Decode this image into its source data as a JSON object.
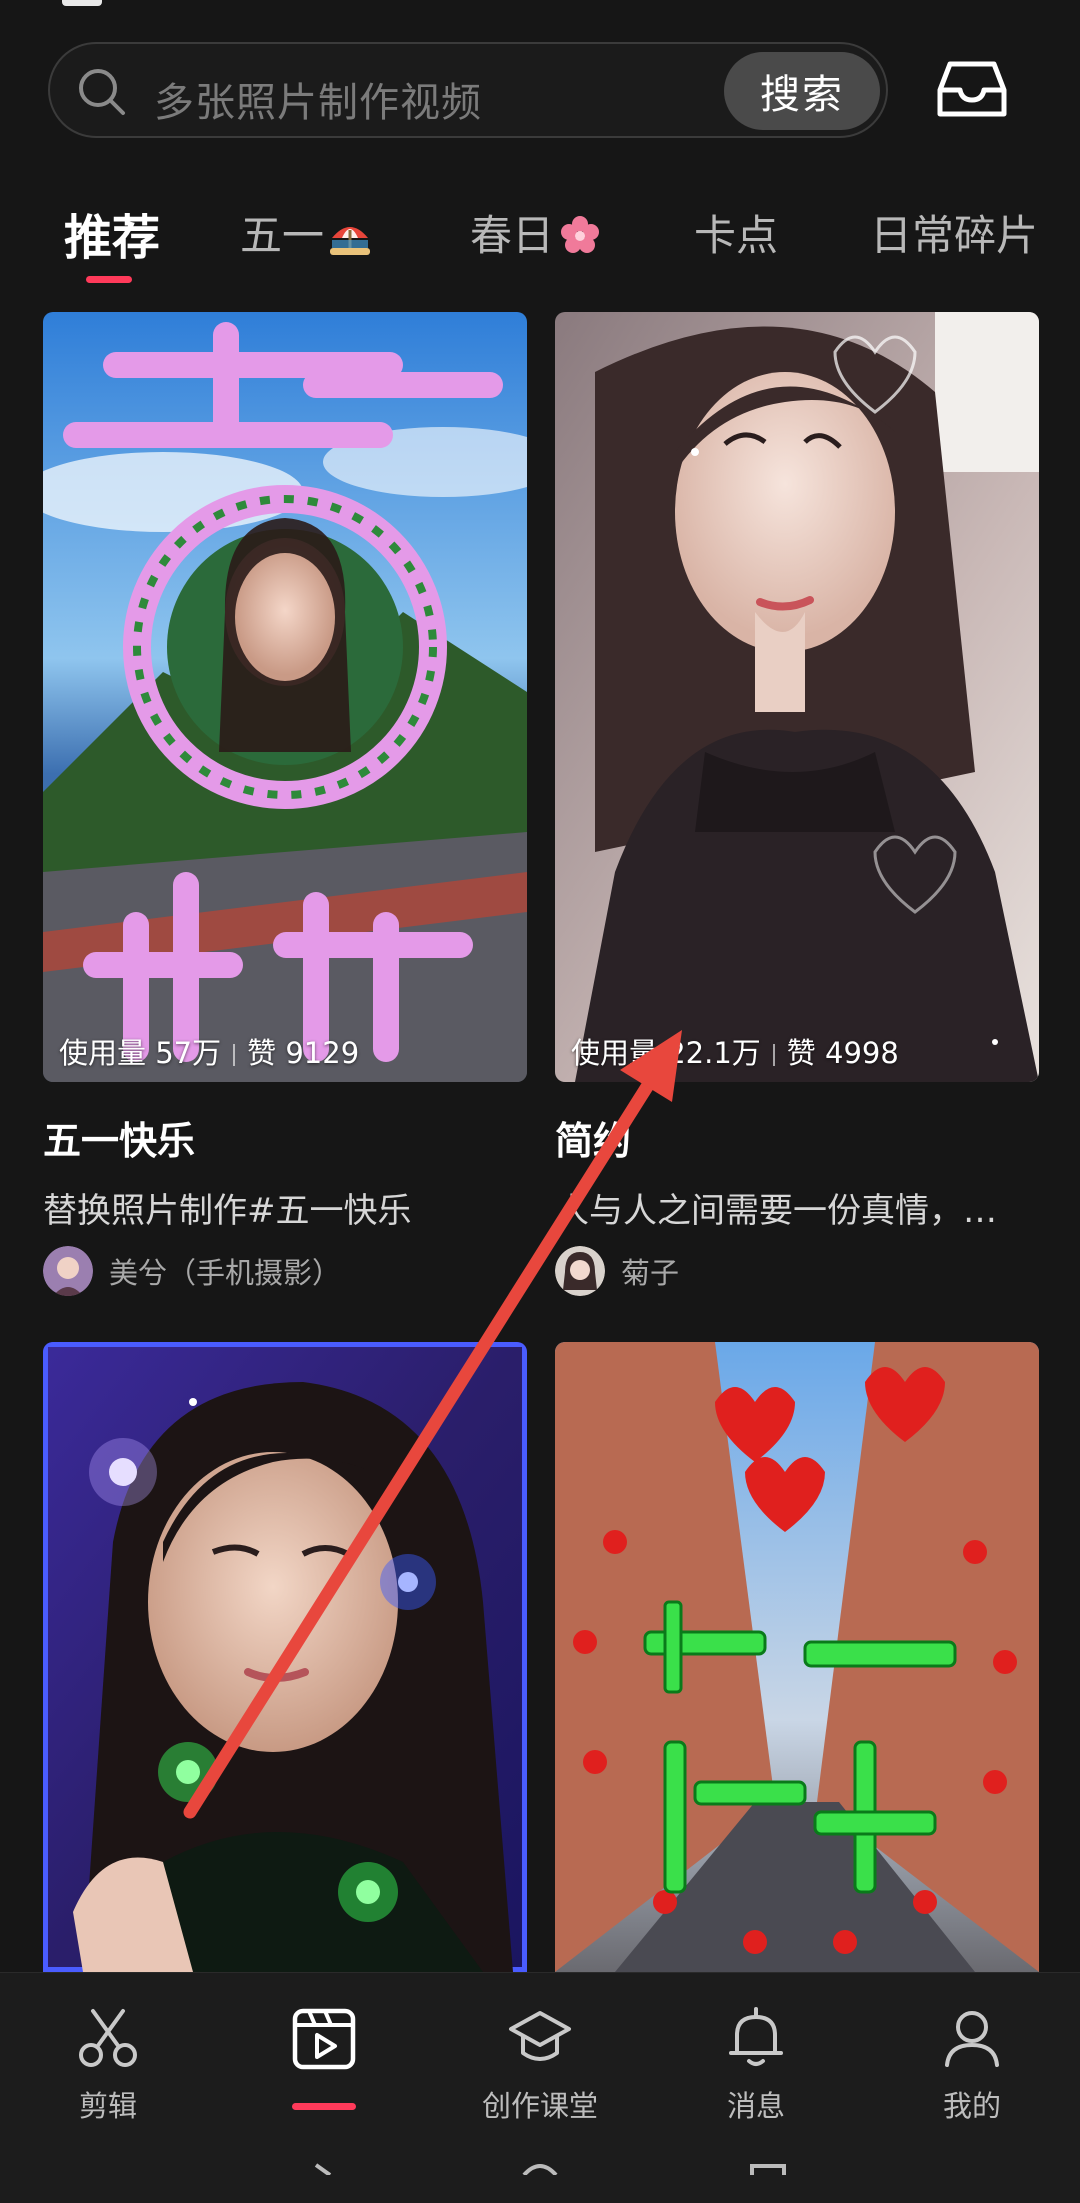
{
  "search": {
    "placeholder": "多张照片制作视频",
    "button_label": "搜索"
  },
  "tabs": [
    {
      "label": "推荐",
      "active": true
    },
    {
      "label": "五一",
      "icon": "beach-umbrella-icon"
    },
    {
      "label": "春日",
      "icon": "cherry-blossom-icon"
    },
    {
      "label": "卡点"
    },
    {
      "label": "日常碎片"
    }
  ],
  "cards": [
    {
      "usage": "使用量 57万",
      "likes": "赞 9129",
      "title": "五一快乐",
      "desc": "替换照片制作#五一快乐",
      "author": "美兮（手机摄影）"
    },
    {
      "usage": "使用量 22.1万",
      "likes": "赞 4998",
      "title": "简约",
      "desc": "人与人之间需要一份真情，…",
      "author": "菊子"
    },
    {},
    {}
  ],
  "bottom_nav": [
    {
      "label": "剪辑",
      "icon": "scissors-icon"
    },
    {
      "label": "",
      "icon": "clapperboard-icon",
      "active": true
    },
    {
      "label": "创作课堂",
      "icon": "graduation-cap-icon"
    },
    {
      "label": "消息",
      "icon": "bell-icon"
    },
    {
      "label": "我的",
      "icon": "person-icon"
    }
  ],
  "colors": {
    "background": "#161616",
    "accent": "#ff3a5a",
    "annotation_arrow": "#e8473d"
  }
}
